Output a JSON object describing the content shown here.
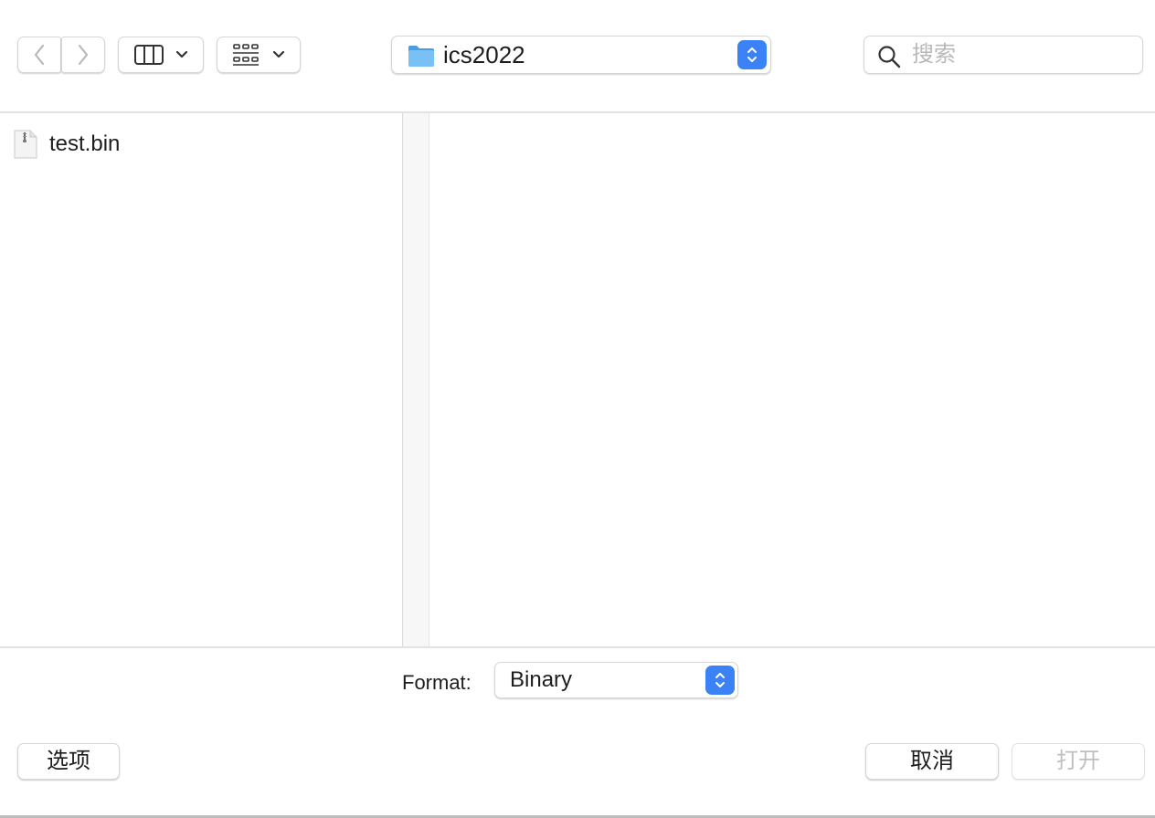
{
  "toolbar": {
    "back_icon": "chevron-left-icon",
    "forward_icon": "chevron-right-icon",
    "view_icon": "column-view-icon",
    "group_icon": "group-grid-icon",
    "path": {
      "folder_icon": "folder-icon",
      "label": "ics2022"
    },
    "search": {
      "icon": "search-icon",
      "placeholder": "搜索",
      "value": ""
    }
  },
  "browser": {
    "columns": [
      {
        "items": [
          {
            "name": "test.bin",
            "icon": "document-icon"
          }
        ]
      },
      {
        "items": []
      }
    ]
  },
  "format": {
    "label": "Format:",
    "value": "Binary"
  },
  "buttons": {
    "options": "选项",
    "cancel": "取消",
    "open": "打开"
  },
  "colors": {
    "accent": "#3b82f6",
    "folder": "#6cb8f0",
    "disabled_text": "#bfbfbf"
  }
}
